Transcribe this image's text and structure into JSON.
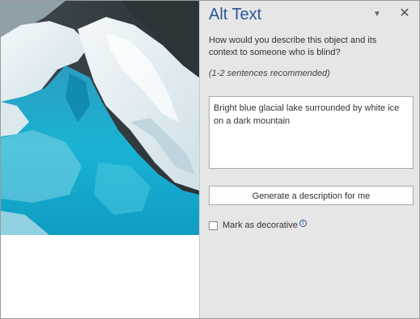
{
  "pane": {
    "title": "Alt Text",
    "menu_icon": "chevron-down-icon",
    "close_icon": "close-icon",
    "question": "How would you describe this object and its context to someone who is blind?",
    "hint": "(1-2 sentences recommended)",
    "description_value": "Bright blue glacial lake surrounded by white ice on a dark mountain",
    "generate_button_label": "Generate a description for me",
    "decorative_label": "Mark as decorative",
    "decorative_checked": false,
    "info_icon": "info-icon"
  },
  "colors": {
    "title_blue": "#2b579a",
    "pane_background": "#e6e6e6",
    "glacier_water": "#1aa8c8",
    "ice": "#e8f1f5"
  }
}
